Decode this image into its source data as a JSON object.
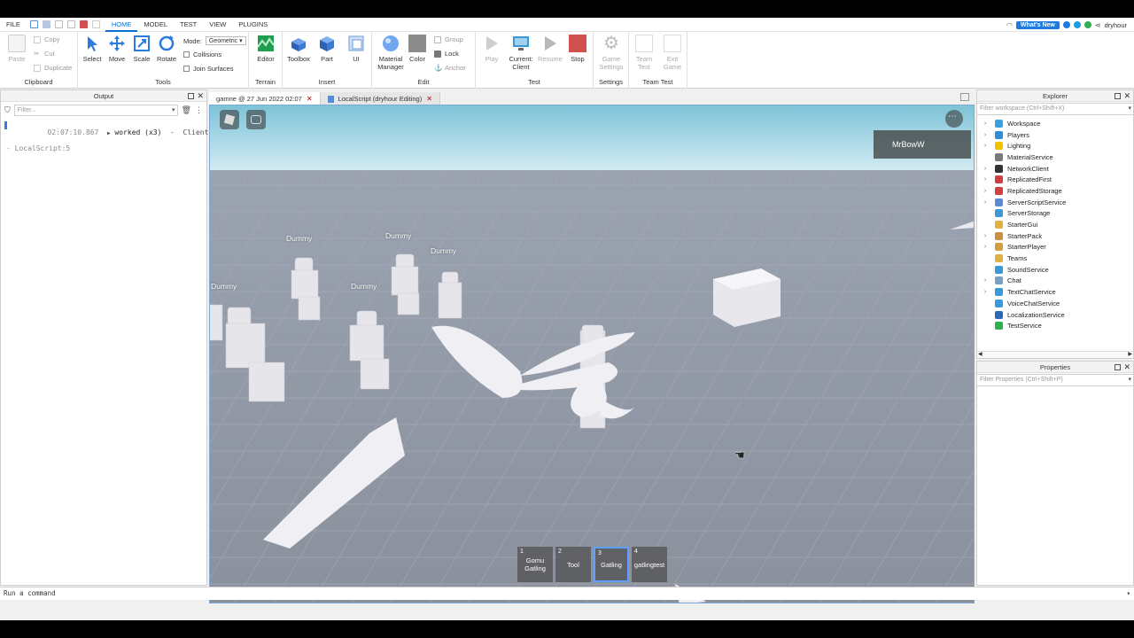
{
  "menubar": {
    "file": "FILE",
    "tabs": [
      "HOME",
      "MODEL",
      "TEST",
      "VIEW",
      "PLUGINS"
    ],
    "whats_new": "What's New",
    "username": "dryhour"
  },
  "ribbon": {
    "clipboard": {
      "paste": "Paste",
      "copy": "Copy",
      "cut": "Cut",
      "duplicate": "Duplicate",
      "label": "Clipboard"
    },
    "tools": {
      "select": "Select",
      "move": "Move",
      "scale": "Scale",
      "rotate": "Rotate",
      "mode_label": "Mode:",
      "mode_value": "Geometric",
      "collisions": "Collisions",
      "join_surfaces": "Join Surfaces",
      "label": "Tools"
    },
    "terrain": {
      "editor": "Editor",
      "label": "Terrain"
    },
    "insert": {
      "toolbox": "Toolbox",
      "part": "Part",
      "ui": "UI",
      "label": "Insert"
    },
    "edit": {
      "material_manager_1": "Material",
      "material_manager_2": "Manager",
      "color": "Color",
      "group": "Group",
      "lock": "Lock",
      "anchor": "Anchor",
      "label": "Edit"
    },
    "test": {
      "play": "Play",
      "current_client_1": "Current:",
      "current_client_2": "Client",
      "resume": "Resume",
      "stop": "Stop",
      "label": "Test"
    },
    "settings": {
      "game_settings_1": "Game",
      "game_settings_2": "Settings",
      "label": "Settings"
    },
    "team_test": {
      "team_test_1": "Team",
      "team_test_2": "Test",
      "exit_game_1": "Exit",
      "exit_game_2": "Game",
      "label": "Team Test"
    }
  },
  "output": {
    "title": "Output",
    "filter_placeholder": "Filter...",
    "timestamp": "02:07:10.867",
    "message": "worked (x3)",
    "context": "Client",
    "source": "- LocalScript:5"
  },
  "tabs": [
    {
      "label": "gamne @ 27 Jun 2022 02:07"
    },
    {
      "label": "LocalScript (dryhour Editing)"
    }
  ],
  "viewport": {
    "player_name": "MrBowW",
    "dummy_label": "Dummy",
    "hotbar": [
      {
        "num": "1",
        "label": "Gomu Gatling"
      },
      {
        "num": "2",
        "label": "Tool"
      },
      {
        "num": "3",
        "label": "Gatling"
      },
      {
        "num": "4",
        "label": "gatlingtest"
      }
    ]
  },
  "explorer": {
    "title": "Explorer",
    "filter_placeholder": "Filter workspace (Ctrl+Shift+X)",
    "items": [
      {
        "label": "Workspace",
        "expandable": true,
        "color": "#3aa0e0"
      },
      {
        "label": "Players",
        "expandable": true,
        "color": "#2e8fd8"
      },
      {
        "label": "Lighting",
        "expandable": true,
        "color": "#f2c200"
      },
      {
        "label": "MaterialService",
        "expandable": false,
        "color": "#7a7a7a"
      },
      {
        "label": "NetworkClient",
        "expandable": true,
        "color": "#333333"
      },
      {
        "label": "ReplicatedFirst",
        "expandable": true,
        "color": "#d04040"
      },
      {
        "label": "ReplicatedStorage",
        "expandable": true,
        "color": "#d04040"
      },
      {
        "label": "ServerScriptService",
        "expandable": true,
        "color": "#5a8ad0"
      },
      {
        "label": "ServerStorage",
        "expandable": false,
        "color": "#3a9ad8"
      },
      {
        "label": "StarterGui",
        "expandable": false,
        "color": "#e0b040"
      },
      {
        "label": "StarterPack",
        "expandable": true,
        "color": "#c89040"
      },
      {
        "label": "StarterPlayer",
        "expandable": true,
        "color": "#d0a040"
      },
      {
        "label": "Teams",
        "expandable": false,
        "color": "#e0b040"
      },
      {
        "label": "SoundService",
        "expandable": false,
        "color": "#3a9ad8"
      },
      {
        "label": "Chat",
        "expandable": true,
        "color": "#7aa0c8"
      },
      {
        "label": "TextChatService",
        "expandable": true,
        "color": "#3a9ad8"
      },
      {
        "label": "VoiceChatService",
        "expandable": false,
        "color": "#3a9ad8"
      },
      {
        "label": "LocalizationService",
        "expandable": false,
        "color": "#2a6ab8"
      },
      {
        "label": "TestService",
        "expandable": false,
        "color": "#30b050"
      }
    ]
  },
  "properties": {
    "title": "Properties",
    "filter_placeholder": "Filter Properties (Ctrl+Shift+P)"
  },
  "command_bar": {
    "placeholder": "Run a command"
  }
}
